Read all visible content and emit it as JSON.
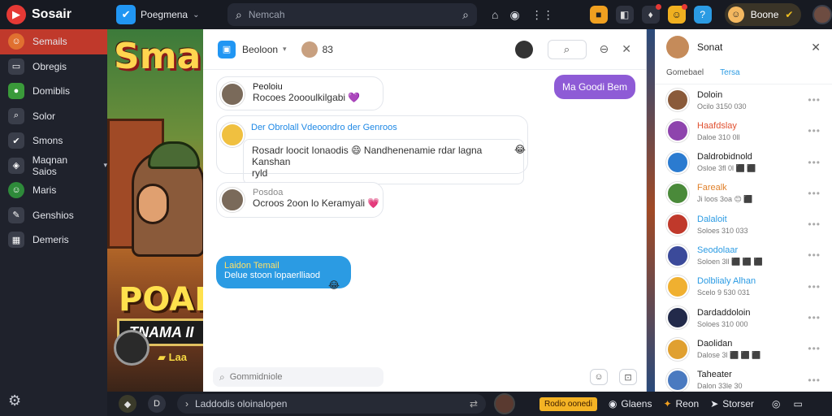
{
  "app": {
    "name": "Sosair",
    "logo_icon": "play-icon"
  },
  "switcher": {
    "label": "Poegmena"
  },
  "search": {
    "placeholder": "Nemcah"
  },
  "account": {
    "name": "Boone"
  },
  "sidebar": {
    "items": [
      {
        "label": "Semails",
        "icon": "avatar-icon",
        "active": true
      },
      {
        "label": "Obregis",
        "icon": "inbox-icon"
      },
      {
        "label": "Domiblis",
        "icon": "game-icon"
      },
      {
        "label": "Solor",
        "icon": "search-icon"
      },
      {
        "label": "Smons",
        "icon": "check-icon"
      },
      {
        "label": "Maqnan Saios",
        "icon": "bookmark-icon",
        "has_chevron": true
      },
      {
        "label": "Maris",
        "icon": "avatar-icon"
      },
      {
        "label": "Genshios",
        "icon": "pencil-icon"
      },
      {
        "label": "Demeris",
        "icon": "calendar-icon"
      }
    ]
  },
  "chat": {
    "header": {
      "name": "Beoloon",
      "participant_count": "83"
    },
    "messages": [
      {
        "name": "Peoloiu",
        "text": "Rocoes 2oooulkilgabi",
        "emoji": "💜"
      },
      {
        "name": "Der Obrolall Vdeoondro der Genroos",
        "text": "Rosadr loocit Ionaodis 😄 Nandhenenamie rdar lagna Kanshan",
        "text2": "ryld",
        "emoji": "😂"
      },
      {
        "name": "Posdoa",
        "text": "Ocroos 2oon lo Keramyali",
        "emoji": "💗"
      }
    ],
    "my_message": "Ma Goodi Bem",
    "blue_message": {
      "title": "Laidon Temail",
      "text": "Delue stoon lopaerlliaod",
      "emoji": "😂"
    },
    "compose_placeholder": "Gommidniole"
  },
  "right_panel": {
    "title": "Sonat",
    "tabs": [
      "Gomebael",
      "Tersa"
    ],
    "contacts": [
      {
        "name": "Doloin",
        "sub": "Ocilo 3150 030",
        "color": "#222222",
        "avatar": "#8a5a3a"
      },
      {
        "name": "Haafdslay",
        "sub": "Daloe 310 0ll",
        "color": "#e05030",
        "avatar": "#8e44ad"
      },
      {
        "name": "Daldrobidnold",
        "sub": "Osloe 3fl 0l ⬛ ⬛",
        "color": "#222222",
        "avatar": "#2b7bd0"
      },
      {
        "name": "Farealk",
        "sub": "Ji loos 3oa 😊 ⬛",
        "color": "#e0802a",
        "avatar": "#4a8a3a"
      },
      {
        "name": "Dalaloit",
        "sub": "Soloes 310 033",
        "color": "#2b9be3",
        "avatar": "#c0392b"
      },
      {
        "name": "Seodolaar",
        "sub": "Soloen 3ll ⬛ ⬛ ⬛",
        "color": "#2b9be3",
        "avatar": "#3b4a9a"
      },
      {
        "name": "Dolblialy Alhan",
        "sub": "Scelo 9 530 031",
        "color": "#2b9be3",
        "avatar": "#f0b030"
      },
      {
        "name": "Dardaddoloin",
        "sub": "Soloes 310 000",
        "color": "#222222",
        "avatar": "#222a4a"
      },
      {
        "name": "Daolidan",
        "sub": "Dalose 3l ⬛ ⬛ ⬛",
        "color": "#222222",
        "avatar": "#e0a030"
      },
      {
        "name": "Taheater",
        "sub": "Dalon 33le 30",
        "color": "#222222",
        "avatar": "#4a7ac0"
      }
    ]
  },
  "bottom_bar": {
    "input_placeholder": "Laddodis oloinalopen",
    "badge": "Rodio oonedi",
    "links": [
      "Glaens",
      "Reon",
      "Storser"
    ]
  },
  "art": {
    "title": "Smal",
    "big_text": "POAR",
    "banner": "TNAMA II",
    "label": "Laa"
  }
}
